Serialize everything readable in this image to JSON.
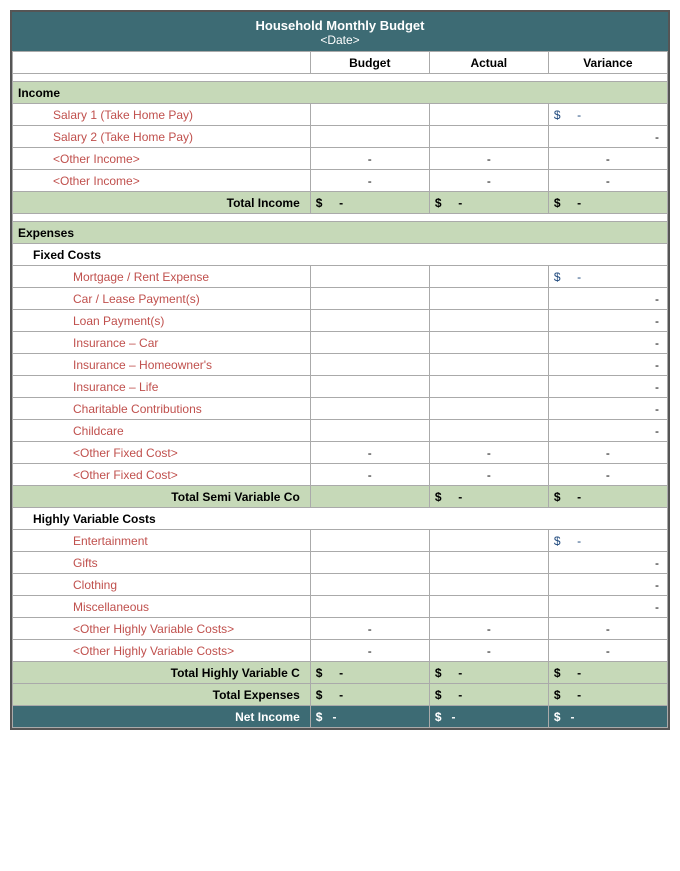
{
  "header": {
    "title": "Household Monthly Budget",
    "subtitle": "<Date>"
  },
  "columns": {
    "label": "",
    "budget": "Budget",
    "actual": "Actual",
    "variance": "Variance"
  },
  "income": {
    "label": "Income",
    "rows": [
      {
        "label": "Salary 1 (Take Home Pay)",
        "budget": "",
        "actual": "",
        "variance_dollar": "$",
        "variance": "-"
      },
      {
        "label": "Salary 2 (Take Home Pay)",
        "budget": "",
        "actual": "",
        "variance": "-"
      },
      {
        "label": "<Other Income>",
        "budget": "-",
        "actual": "-",
        "variance": "-"
      },
      {
        "label": "<Other Income>",
        "budget": "-",
        "actual": "-",
        "variance": "-"
      }
    ],
    "total": {
      "label": "Total Income",
      "budget_dollar": "$",
      "budget": "-",
      "actual_dollar": "$",
      "actual": "-",
      "variance_dollar": "$",
      "variance": "-"
    }
  },
  "expenses": {
    "label": "Expenses",
    "fixed": {
      "label": "Fixed Costs",
      "rows": [
        {
          "label": "Mortgage / Rent Expense",
          "budget": "",
          "actual": "",
          "variance_dollar": "$",
          "variance": "-"
        },
        {
          "label": "Car / Lease Payment(s)",
          "budget": "",
          "actual": "",
          "variance": "-"
        },
        {
          "label": "Loan Payment(s)",
          "budget": "",
          "actual": "",
          "variance": "-"
        },
        {
          "label": "Insurance – Car",
          "budget": "",
          "actual": "",
          "variance": "-"
        },
        {
          "label": "Insurance – Homeowner's",
          "budget": "",
          "actual": "",
          "variance": "-"
        },
        {
          "label": "Insurance – Life",
          "budget": "",
          "actual": "",
          "variance": "-"
        },
        {
          "label": "Charitable Contributions",
          "budget": "",
          "actual": "",
          "variance": "-"
        },
        {
          "label": "Childcare",
          "budget": "",
          "actual": "",
          "variance": "-"
        },
        {
          "label": "<Other Fixed Cost>",
          "budget": "-",
          "actual": "-",
          "variance": "-"
        },
        {
          "label": "<Other Fixed Cost>",
          "budget": "-",
          "actual": "-",
          "variance": "-"
        }
      ],
      "total": {
        "label": "Total Semi Variable Co",
        "actual_dollar": "$",
        "actual": "-",
        "variance_dollar": "$",
        "variance": "-"
      }
    },
    "variable": {
      "label": "Highly Variable Costs",
      "rows": [
        {
          "label": "Entertainment",
          "budget": "",
          "actual": "",
          "variance_dollar": "$",
          "variance": "-"
        },
        {
          "label": "Gifts",
          "budget": "",
          "actual": "",
          "variance": "-"
        },
        {
          "label": "Clothing",
          "budget": "",
          "actual": "",
          "variance": "-"
        },
        {
          "label": "Miscellaneous",
          "budget": "",
          "actual": "",
          "variance": "-"
        },
        {
          "label": "<Other Highly Variable Costs>",
          "budget": "-",
          "actual": "-",
          "variance": "-"
        },
        {
          "label": "<Other Highly Variable Costs>",
          "budget": "-",
          "actual": "-",
          "variance": "-"
        }
      ],
      "total": {
        "label": "Total Highly Variable C",
        "budget_dollar": "$",
        "budget": "-",
        "actual_dollar": "$",
        "actual": "-",
        "variance_dollar": "$",
        "variance": "-"
      }
    },
    "total_expenses": {
      "label": "Total Expenses",
      "budget_dollar": "$",
      "budget": "-",
      "actual_dollar": "$",
      "actual": "-",
      "variance_dollar": "$",
      "variance": "-"
    }
  },
  "net_income": {
    "label": "Net Income",
    "budget_dollar": "$",
    "budget": "-",
    "actual_dollar": "$",
    "actual": "-",
    "variance_dollar": "$",
    "variance": "-"
  }
}
